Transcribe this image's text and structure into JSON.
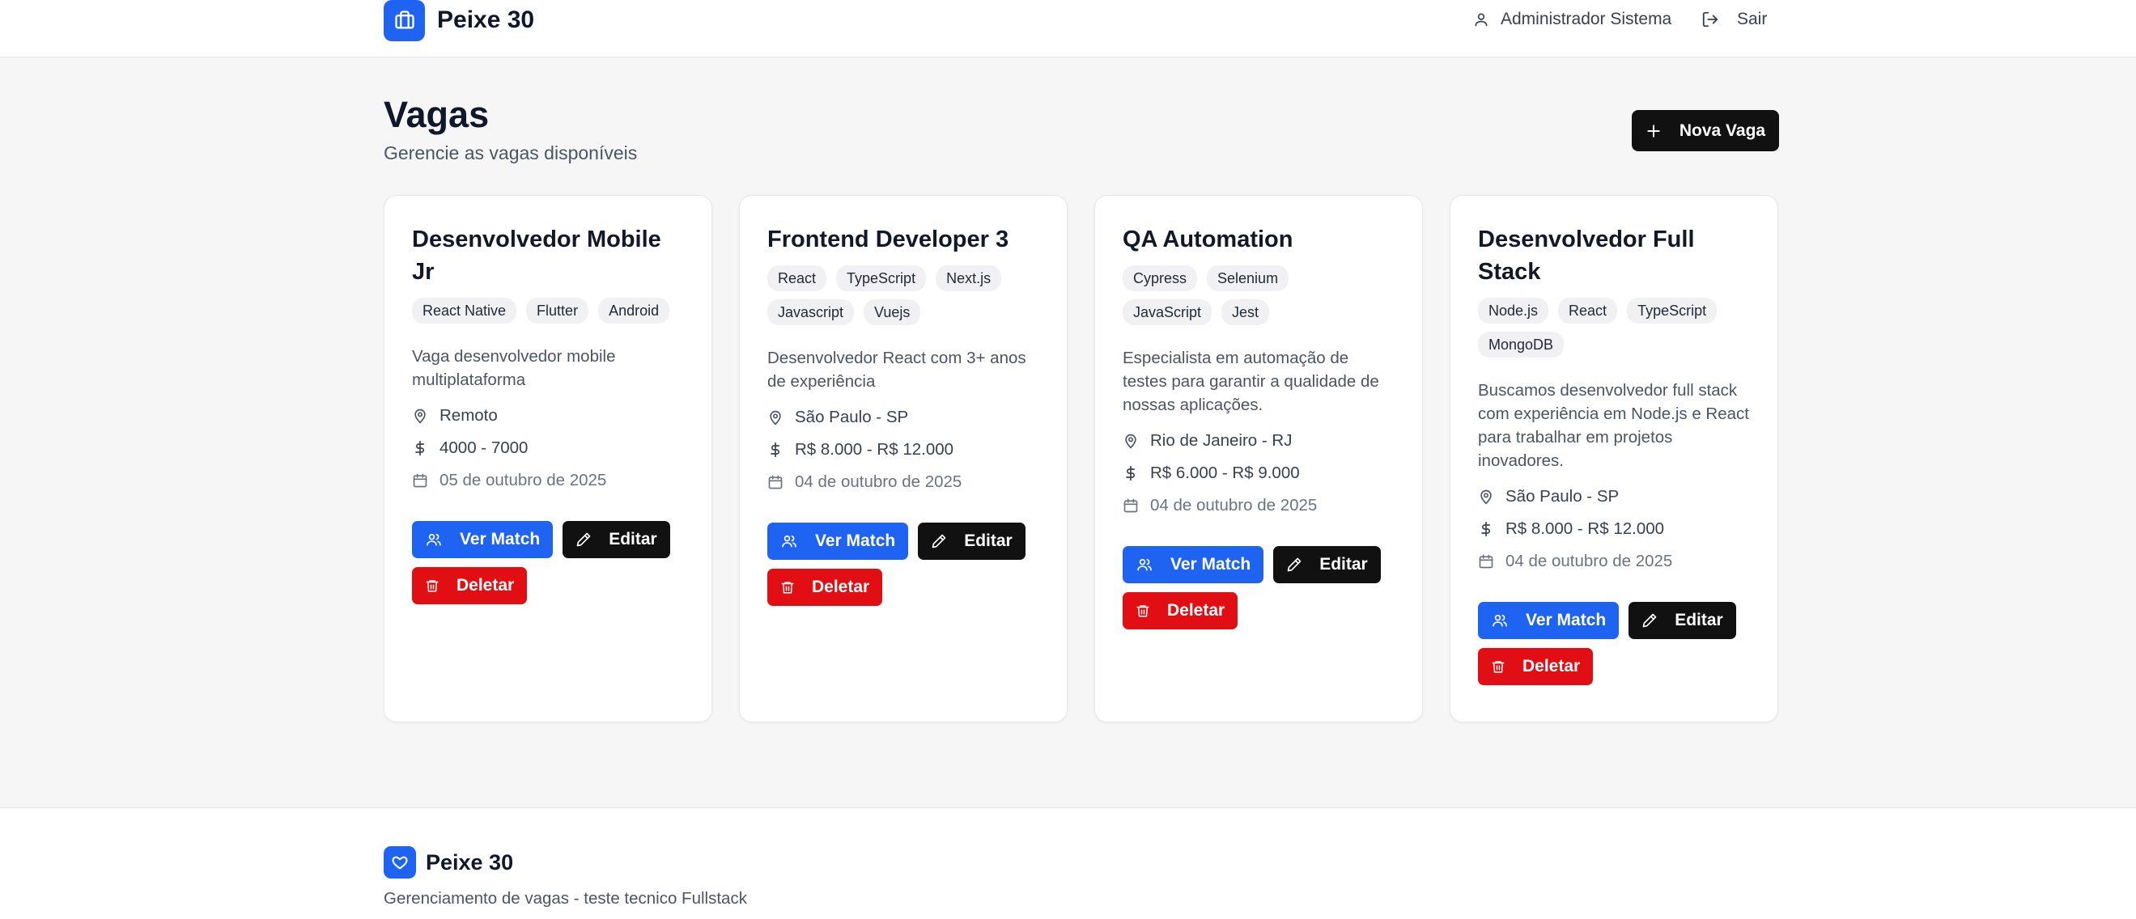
{
  "header": {
    "brand": "Peixe 30",
    "user_name": "Administrador Sistema",
    "logout_label": "Sair"
  },
  "page": {
    "title": "Vagas",
    "subtitle": "Gerencie as vagas disponíveis",
    "new_button": "Nova Vaga"
  },
  "buttons": {
    "match": "Ver Match",
    "edit": "Editar",
    "delete": "Deletar"
  },
  "jobs": [
    {
      "title": "Desenvolvedor Mobile Jr",
      "tags": [
        "React Native",
        "Flutter",
        "Android"
      ],
      "description": "Vaga desenvolvedor mobile multiplataforma",
      "location": "Remoto",
      "salary": "4000 - 7000",
      "date": "05 de outubro de 2025"
    },
    {
      "title": "Frontend Developer 3",
      "tags": [
        "React",
        "TypeScript",
        "Next.js",
        "Javascript",
        "Vuejs"
      ],
      "description": "Desenvolvedor React com 3+ anos de experiência",
      "location": "São Paulo - SP",
      "salary": "R$ 8.000 - R$ 12.000",
      "date": "04 de outubro de 2025"
    },
    {
      "title": "QA Automation",
      "tags": [
        "Cypress",
        "Selenium",
        "JavaScript",
        "Jest"
      ],
      "description": "Especialista em automação de testes para garantir a qualidade de nossas aplicações.",
      "location": "Rio de Janeiro - RJ",
      "salary": "R$ 6.000 - R$ 9.000",
      "date": "04 de outubro de 2025"
    },
    {
      "title": "Desenvolvedor Full Stack",
      "tags": [
        "Node.js",
        "React",
        "TypeScript",
        "MongoDB"
      ],
      "description": "Buscamos desenvolvedor full stack com experiência em Node.js e React para trabalhar em projetos inovadores.",
      "location": "São Paulo - SP",
      "salary": "R$ 8.000 - R$ 12.000",
      "date": "04 de outubro de 2025"
    }
  ],
  "footer": {
    "brand": "Peixe 30",
    "subtitle": "Gerenciamento de vagas - teste tecnico Fullstack"
  },
  "colors": {
    "primary": "#1f63f2",
    "dark": "#111111",
    "danger": "#e10e14"
  },
  "icons": {
    "brand": "briefcase-icon",
    "user": "user-icon",
    "logout": "logout-icon",
    "new": "plus-icon",
    "location": "map-pin-icon",
    "salary": "dollar-icon",
    "date": "calendar-icon",
    "match": "users-icon",
    "edit": "pencil-icon",
    "delete": "trash-icon",
    "footer": "heart-icon"
  }
}
